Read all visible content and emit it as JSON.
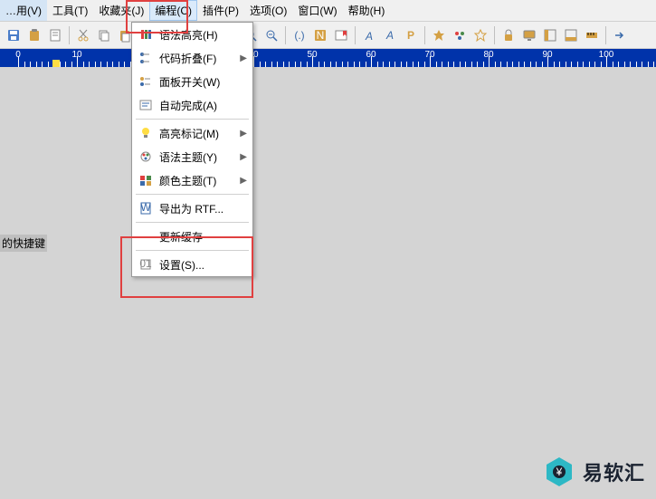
{
  "menubar": {
    "items": [
      {
        "label": "…用(V)"
      },
      {
        "label": "工具(T)"
      },
      {
        "label": "收藏夹(J)"
      },
      {
        "label": "编程(C)"
      },
      {
        "label": "插件(P)"
      },
      {
        "label": "选项(O)"
      },
      {
        "label": "窗口(W)"
      },
      {
        "label": "帮助(H)"
      }
    ],
    "active_index": 3
  },
  "toolbar_icons": [
    "save",
    "clipboard",
    "file",
    "sep",
    "cut",
    "copy",
    "paste",
    "sep",
    "delete",
    "sep",
    "undo",
    "redo",
    "sep",
    "zoom-in",
    "zoom-reset",
    "zoom-out",
    "sep",
    "braces",
    "n-square",
    "bookmark",
    "sep",
    "text-a",
    "text-a-small",
    "text-p",
    "sep",
    "star",
    "palette",
    "star2",
    "sep",
    "lock",
    "monitor",
    "panel",
    "panel2",
    "ruler",
    "sep",
    "arrow"
  ],
  "ruler": {
    "start": 0,
    "step": 10,
    "count": 12,
    "marks": [
      {
        "pos": 58
      }
    ]
  },
  "content": {
    "shortcut_text": "的快捷键"
  },
  "dropdown": {
    "items": [
      {
        "icon": "highlight",
        "label": "语法高亮(H)"
      },
      {
        "icon": "fold",
        "label": "代码折叠(F)",
        "arrow": true
      },
      {
        "icon": "panel",
        "label": "面板开关(W)"
      },
      {
        "icon": "auto",
        "label": "自动完成(A)"
      },
      {
        "sep": true
      },
      {
        "icon": "bulb",
        "label": "高亮标记(M)",
        "arrow": true
      },
      {
        "icon": "theme",
        "label": "语法主题(Y)",
        "arrow": true
      },
      {
        "icon": "color",
        "label": "颜色主题(T)",
        "arrow": true
      },
      {
        "sep": true
      },
      {
        "icon": "word",
        "label": "导出为 RTF..."
      },
      {
        "sep": true
      },
      {
        "icon": "refresh",
        "label": "更新缓存"
      },
      {
        "sep": true
      },
      {
        "icon": "settings",
        "label": "设置(S)..."
      }
    ]
  },
  "watermark": {
    "text": "易软汇"
  },
  "colors": {
    "ruler_bg": "#0033aa",
    "highlight_border": "#e04040",
    "logo_teal": "#2db8c5"
  }
}
